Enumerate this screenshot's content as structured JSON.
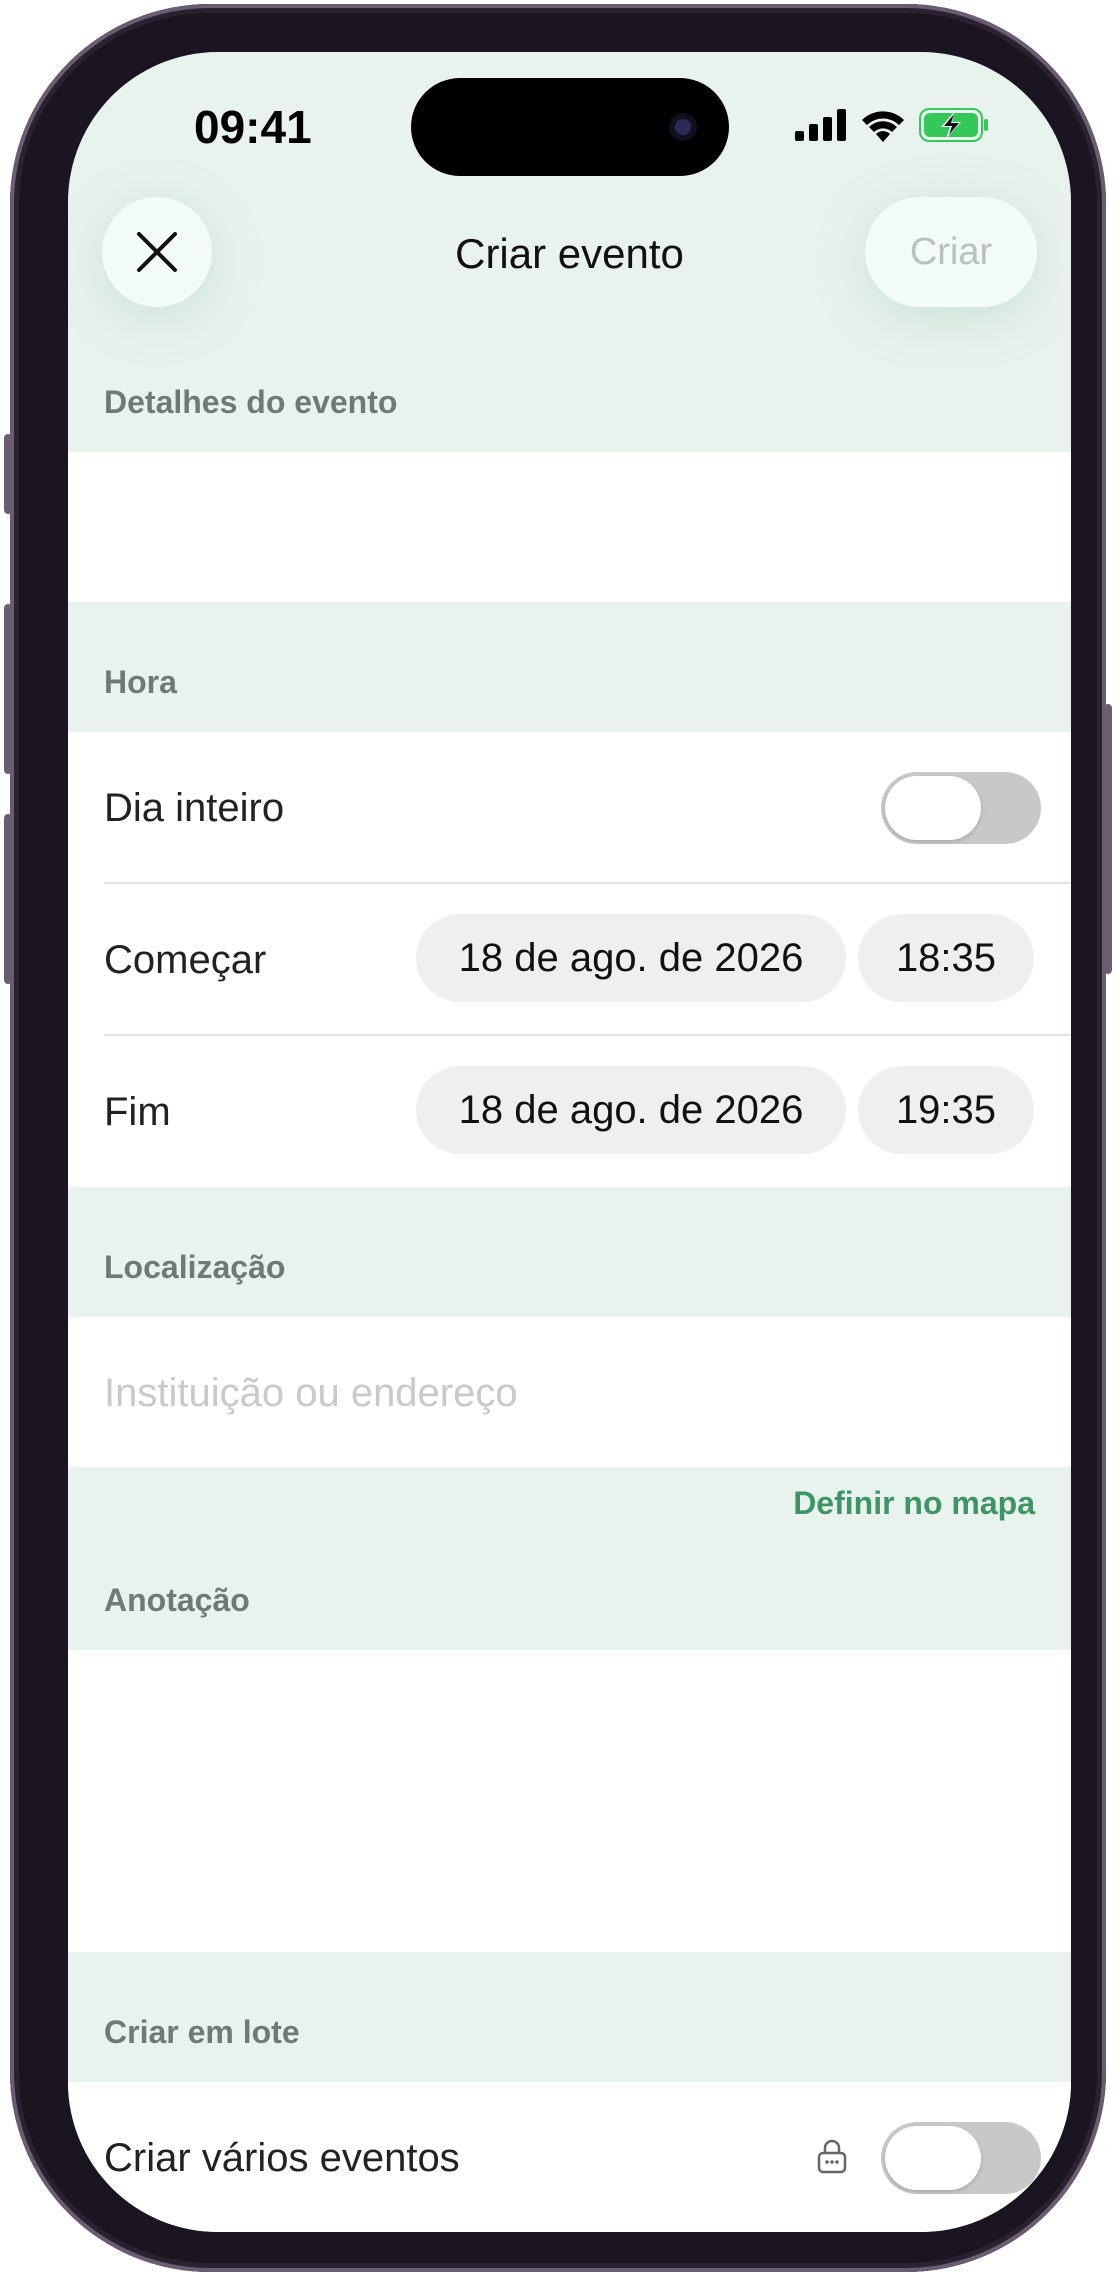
{
  "status_bar": {
    "time": "09:41",
    "signal_icon": "signal-icon",
    "wifi_icon": "wifi-icon",
    "battery_icon": "battery-charging-icon",
    "battery_color": "#34c759"
  },
  "header": {
    "close_icon": "close-icon",
    "title": "Criar evento",
    "create_label": "Criar"
  },
  "sections": {
    "details": {
      "label": "Detalhes do evento"
    },
    "time": {
      "label": "Hora",
      "all_day_label": "Dia inteiro",
      "all_day_on": false,
      "start": {
        "label": "Começar",
        "date": "18 de ago. de 2026",
        "time": "18:35"
      },
      "end": {
        "label": "Fim",
        "date": "18 de ago. de 2026",
        "time": "19:35"
      }
    },
    "location": {
      "label": "Localização",
      "placeholder": "Instituição ou endereço",
      "map_link": "Definir no mapa"
    },
    "note": {
      "label": "Anotação"
    },
    "batch": {
      "label": "Criar em lote",
      "multi_label": "Criar vários eventos",
      "lock_icon": "lock-icon",
      "multi_on": false
    }
  },
  "colors": {
    "background": "#e8f3ed",
    "accent": "#3e9467"
  }
}
